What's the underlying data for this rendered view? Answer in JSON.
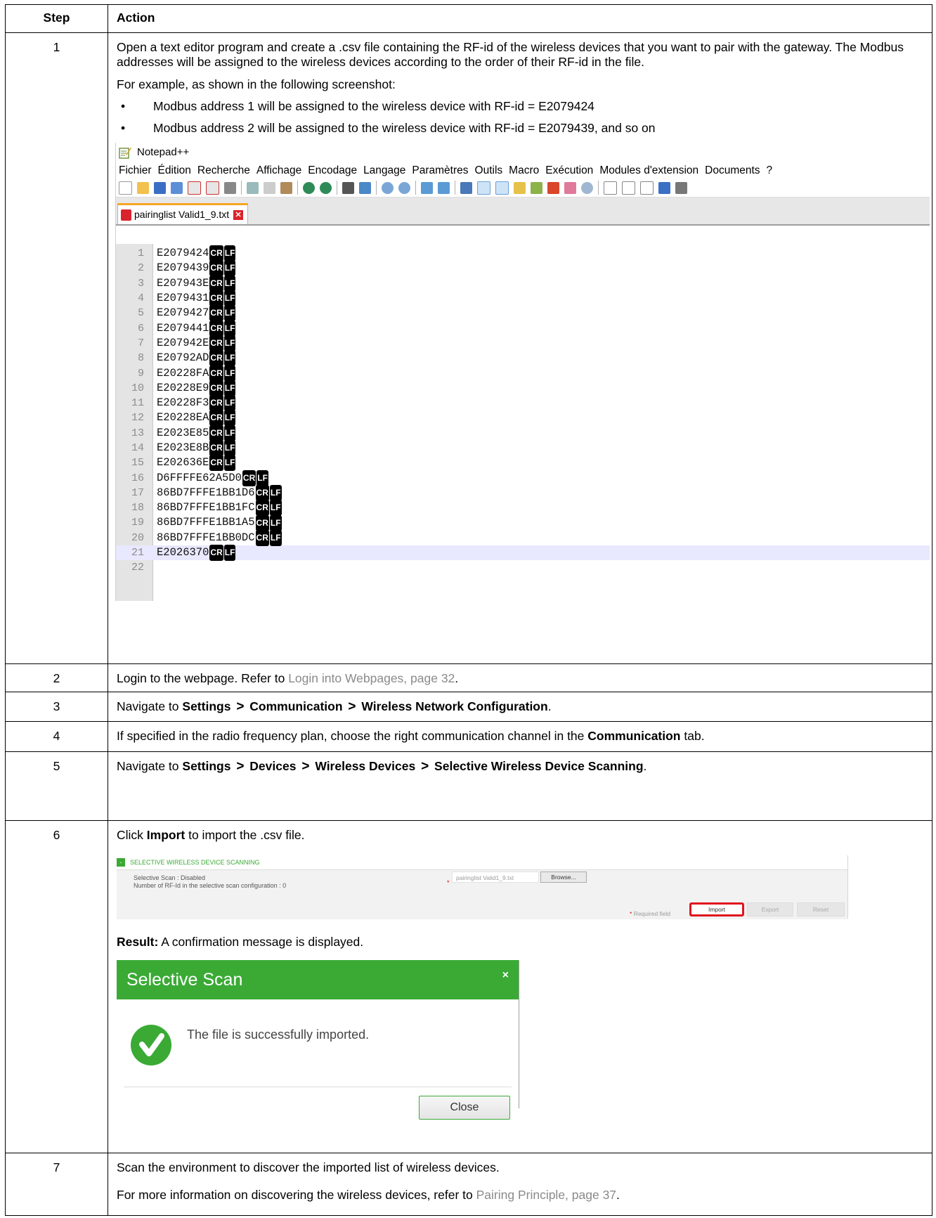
{
  "table": {
    "col_step": "Step",
    "col_action": "Action"
  },
  "step1": {
    "num": "1",
    "p1": "Open a text editor program and create a .csv file containing the RF-id of the wireless devices that you want to pair with the gateway. The Modbus addresses will be assigned to the wireless devices according to the order of their RF-id in the file.",
    "p2": "For example, as shown in the following screenshot:",
    "bullets": [
      "Modbus address 1 will be assigned to the wireless device with RF-id = E2079424",
      "Modbus address 2 will be assigned to the wireless device with RF-id = E2079439, and so on"
    ]
  },
  "notepad": {
    "app_title": "Notepad++",
    "menu": [
      "Fichier",
      "Édition",
      "Recherche",
      "Affichage",
      "Encodage",
      "Langage",
      "Paramètres",
      "Outils",
      "Macro",
      "Exécution",
      "Modules d'extension",
      "Documents",
      "?"
    ],
    "tab_name": "pairinglist Valid1_9.txt",
    "eol_cr": "CR",
    "eol_lf": "LF",
    "lines": [
      {
        "n": "1",
        "text": "E2079424"
      },
      {
        "n": "2",
        "text": "E2079439"
      },
      {
        "n": "3",
        "text": "E207943E"
      },
      {
        "n": "4",
        "text": "E2079431"
      },
      {
        "n": "5",
        "text": "E2079427"
      },
      {
        "n": "6",
        "text": "E2079441"
      },
      {
        "n": "7",
        "text": "E207942E"
      },
      {
        "n": "8",
        "text": "E20792AD"
      },
      {
        "n": "9",
        "text": "E20228FA"
      },
      {
        "n": "10",
        "text": "E20228E9"
      },
      {
        "n": "11",
        "text": "E20228F3"
      },
      {
        "n": "12",
        "text": "E20228EA"
      },
      {
        "n": "13",
        "text": "E2023E85"
      },
      {
        "n": "14",
        "text": "E2023E8B"
      },
      {
        "n": "15",
        "text": "E202636E"
      },
      {
        "n": "16",
        "text": "D6FFFFE62A5D0"
      },
      {
        "n": "17",
        "text": "86BD7FFFE1BB1D6"
      },
      {
        "n": "18",
        "text": "86BD7FFFE1BB1FC"
      },
      {
        "n": "19",
        "text": "86BD7FFFE1BB1A5"
      },
      {
        "n": "20",
        "text": "86BD7FFFE1BB0DC"
      },
      {
        "n": "21",
        "text": "E2026370"
      },
      {
        "n": "22",
        "text": ""
      }
    ]
  },
  "step2": {
    "num": "2",
    "text_before": "Login to the webpage. Refer to ",
    "link": "Login into Webpages, page 32",
    "text_after": "."
  },
  "step3": {
    "num": "3",
    "text_before": "Navigate to ",
    "path": [
      "Settings",
      "Communication",
      "Wireless Network Configuration"
    ],
    "sep": ">",
    "text_after": "."
  },
  "step4": {
    "num": "4",
    "text_before": "If specified in the radio frequency plan, choose the right communication channel in the ",
    "bold": "Communication",
    "text_after": " tab."
  },
  "step5": {
    "num": "5",
    "text_before": "Navigate to ",
    "path": [
      "Settings",
      "Devices",
      "Wireless Devices",
      "Selective Wireless Device Scanning"
    ],
    "text_after": "."
  },
  "step6": {
    "num": "6",
    "text_before": "Click ",
    "bold": "Import",
    "text_after": " to import the .csv file.",
    "result_label": "Result:",
    "result_text": " A confirmation message is displayed."
  },
  "scan_panel": {
    "minus": "-",
    "title": "SELECTIVE WIRELESS DEVICE SCANNING",
    "status": "Selective Scan : Disabled",
    "count": "Number of RF-Id in the selective scan configuration : 0",
    "required_star": "*",
    "file_value": "pairinglist Valid1_9.txt",
    "browse": "Browse...",
    "required_label": "Required field",
    "import": "Import",
    "export": "Export",
    "reset": "Reset"
  },
  "dialog": {
    "title": "Selective Scan",
    "close_x": "×",
    "message": "The file is successfully imported.",
    "close_button": "Close"
  },
  "step7": {
    "num": "7",
    "p1": "Scan the environment to discover the imported list of wireless devices.",
    "text_before": "For more information on discovering the wireless devices, refer to ",
    "link": "Pairing Principle, page 37",
    "text_after": "."
  },
  "colors": {
    "green": "#3aaa35",
    "import_highlight": "#e0141e",
    "link_gray": "#8a8a8a"
  }
}
